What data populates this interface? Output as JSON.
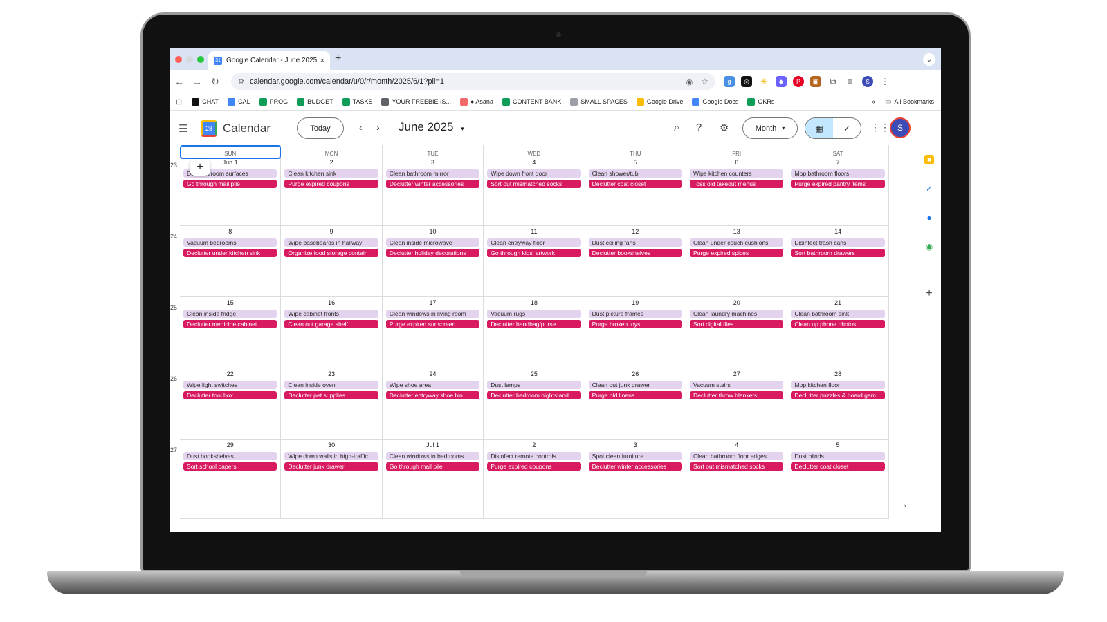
{
  "browser": {
    "tab_title": "Google Calendar - June 2025",
    "tab_close": "×",
    "new_tab": "+",
    "url": "calendar.google.com/calendar/u/0/r/month/2025/6/1?pli=1",
    "profile_initial": "S"
  },
  "bookmarks": {
    "items": [
      {
        "label": "CHAT",
        "icon": "openai-icon",
        "color": "#111111"
      },
      {
        "label": "CAL",
        "icon": "calendar-icon",
        "color": "#4285f4"
      },
      {
        "label": "PROG",
        "icon": "sheets-icon",
        "color": "#0f9d58"
      },
      {
        "label": "BUDGET",
        "icon": "sheets-icon",
        "color": "#0f9d58"
      },
      {
        "label": "TASKS",
        "icon": "sheets-icon",
        "color": "#0f9d58"
      },
      {
        "label": "YOUR FREEBIE IS...",
        "icon": "globe-icon",
        "color": "#5f6368"
      },
      {
        "label": "● Asana",
        "icon": "asana-icon",
        "color": "#f06a6a"
      },
      {
        "label": "CONTENT BANK",
        "icon": "sheets-icon",
        "color": "#0f9d58"
      },
      {
        "label": "SMALL SPACES",
        "icon": "dash-icon",
        "color": "#9aa0a6"
      },
      {
        "label": "Google Drive",
        "icon": "drive-icon",
        "color": "#fbbc04"
      },
      {
        "label": "Google Docs",
        "icon": "docs-icon",
        "color": "#4285f4"
      },
      {
        "label": "OKRs",
        "icon": "sheets-icon",
        "color": "#0f9d58"
      }
    ],
    "more": "»",
    "all_bookmarks": "All Bookmarks"
  },
  "header": {
    "app_name": "Calendar",
    "logo_day": "28",
    "today": "Today",
    "month_title": "June 2025",
    "view": "Month",
    "avatar_initial": "S"
  },
  "weekdays": [
    "SUN",
    "MON",
    "TUE",
    "WED",
    "THU",
    "FRI",
    "SAT"
  ],
  "weeks": [
    {
      "num": "23",
      "days": [
        {
          "date": "Jun 1",
          "clean": "Dust bedroom surfaces",
          "declutter": "Go through mail pile"
        },
        {
          "date": "2",
          "clean": "Clean kitchen sink",
          "declutter": "Purge expired coupons"
        },
        {
          "date": "3",
          "clean": "Clean bathroom mirror",
          "declutter": "Declutter winter accessories"
        },
        {
          "date": "4",
          "clean": "Wipe down front door",
          "declutter": "Sort out mismatched socks"
        },
        {
          "date": "5",
          "clean": "Clean shower/tub",
          "declutter": "Declutter coat closet"
        },
        {
          "date": "6",
          "clean": "Wipe kitchen counters",
          "declutter": "Toss old takeout menus"
        },
        {
          "date": "7",
          "clean": "Mop bathroom floors",
          "declutter": "Purge expired pantry items"
        }
      ]
    },
    {
      "num": "24",
      "days": [
        {
          "date": "8",
          "clean": "Vacuum bedrooms",
          "declutter": "Declutter under kitchen sink"
        },
        {
          "date": "9",
          "clean": "Wipe baseboards in hallway",
          "declutter": "Organize food storage contain"
        },
        {
          "date": "10",
          "clean": "Clean inside microwave",
          "declutter": "Declutter holiday decorations"
        },
        {
          "date": "11",
          "clean": "Clean entryway floor",
          "declutter": "Go through kids' artwork"
        },
        {
          "date": "12",
          "clean": "Dust ceiling fans",
          "declutter": "Declutter bookshelves"
        },
        {
          "date": "13",
          "clean": "Clean under couch cushions",
          "declutter": "Purge expired spices"
        },
        {
          "date": "14",
          "clean": "Disinfect trash cans",
          "declutter": "Sort bathroom drawers"
        }
      ]
    },
    {
      "num": "25",
      "days": [
        {
          "date": "15",
          "clean": "Clean inside fridge",
          "declutter": "Declutter medicine cabinet"
        },
        {
          "date": "16",
          "clean": "Wipe cabinet fronts",
          "declutter": "Clean out garage shelf"
        },
        {
          "date": "17",
          "clean": "Clean windows in living room",
          "declutter": "Purge expired sunscreen"
        },
        {
          "date": "18",
          "clean": "Vacuum rugs",
          "declutter": "Declutter handbag/purse"
        },
        {
          "date": "19",
          "clean": "Dust picture frames",
          "declutter": "Purge broken toys"
        },
        {
          "date": "20",
          "clean": "Clean laundry machines",
          "declutter": "Sort digital files"
        },
        {
          "date": "21",
          "clean": "Clean bathroom sink",
          "declutter": "Clean up phone photos"
        }
      ]
    },
    {
      "num": "26",
      "days": [
        {
          "date": "22",
          "clean": "Wipe light switches",
          "declutter": "Declutter tool box"
        },
        {
          "date": "23",
          "clean": "Clean inside oven",
          "declutter": "Declutter pet supplies"
        },
        {
          "date": "24",
          "clean": "Wipe shoe area",
          "declutter": "Declutter entryway shoe bin"
        },
        {
          "date": "25",
          "clean": "Dust lamps",
          "declutter": "Declutter bedroom nightstand"
        },
        {
          "date": "26",
          "clean": "Clean out junk drawer",
          "declutter": "Purge old linens"
        },
        {
          "date": "27",
          "clean": "Vacuum stairs",
          "declutter": "Declutter throw blankets"
        },
        {
          "date": "28",
          "clean": "Mop kitchen floor",
          "declutter": "Declutter puzzles & board gam"
        }
      ]
    },
    {
      "num": "27",
      "days": [
        {
          "date": "29",
          "clean": "Dust bookshelves",
          "declutter": "Sort school papers"
        },
        {
          "date": "30",
          "clean": "Wipe down walls in high-traffic",
          "declutter": "Declutter junk drawer"
        },
        {
          "date": "Jul 1",
          "clean": "Clean windows in bedrooms",
          "declutter": "Go through mail pile"
        },
        {
          "date": "2",
          "clean": "Disinfect remote controls",
          "declutter": "Purge expired coupons"
        },
        {
          "date": "3",
          "clean": "Spot clean furniture",
          "declutter": "Declutter winter accessories"
        },
        {
          "date": "4",
          "clean": "Clean bathroom floor edges",
          "declutter": "Sort out mismatched socks"
        },
        {
          "date": "5",
          "clean": "Dust blinds",
          "declutter": "Declutter coat closet"
        }
      ]
    }
  ],
  "colors": {
    "clean_event": "#e3d3ee",
    "declutter_event": "#d81b60",
    "accent": "#1a73e8"
  }
}
